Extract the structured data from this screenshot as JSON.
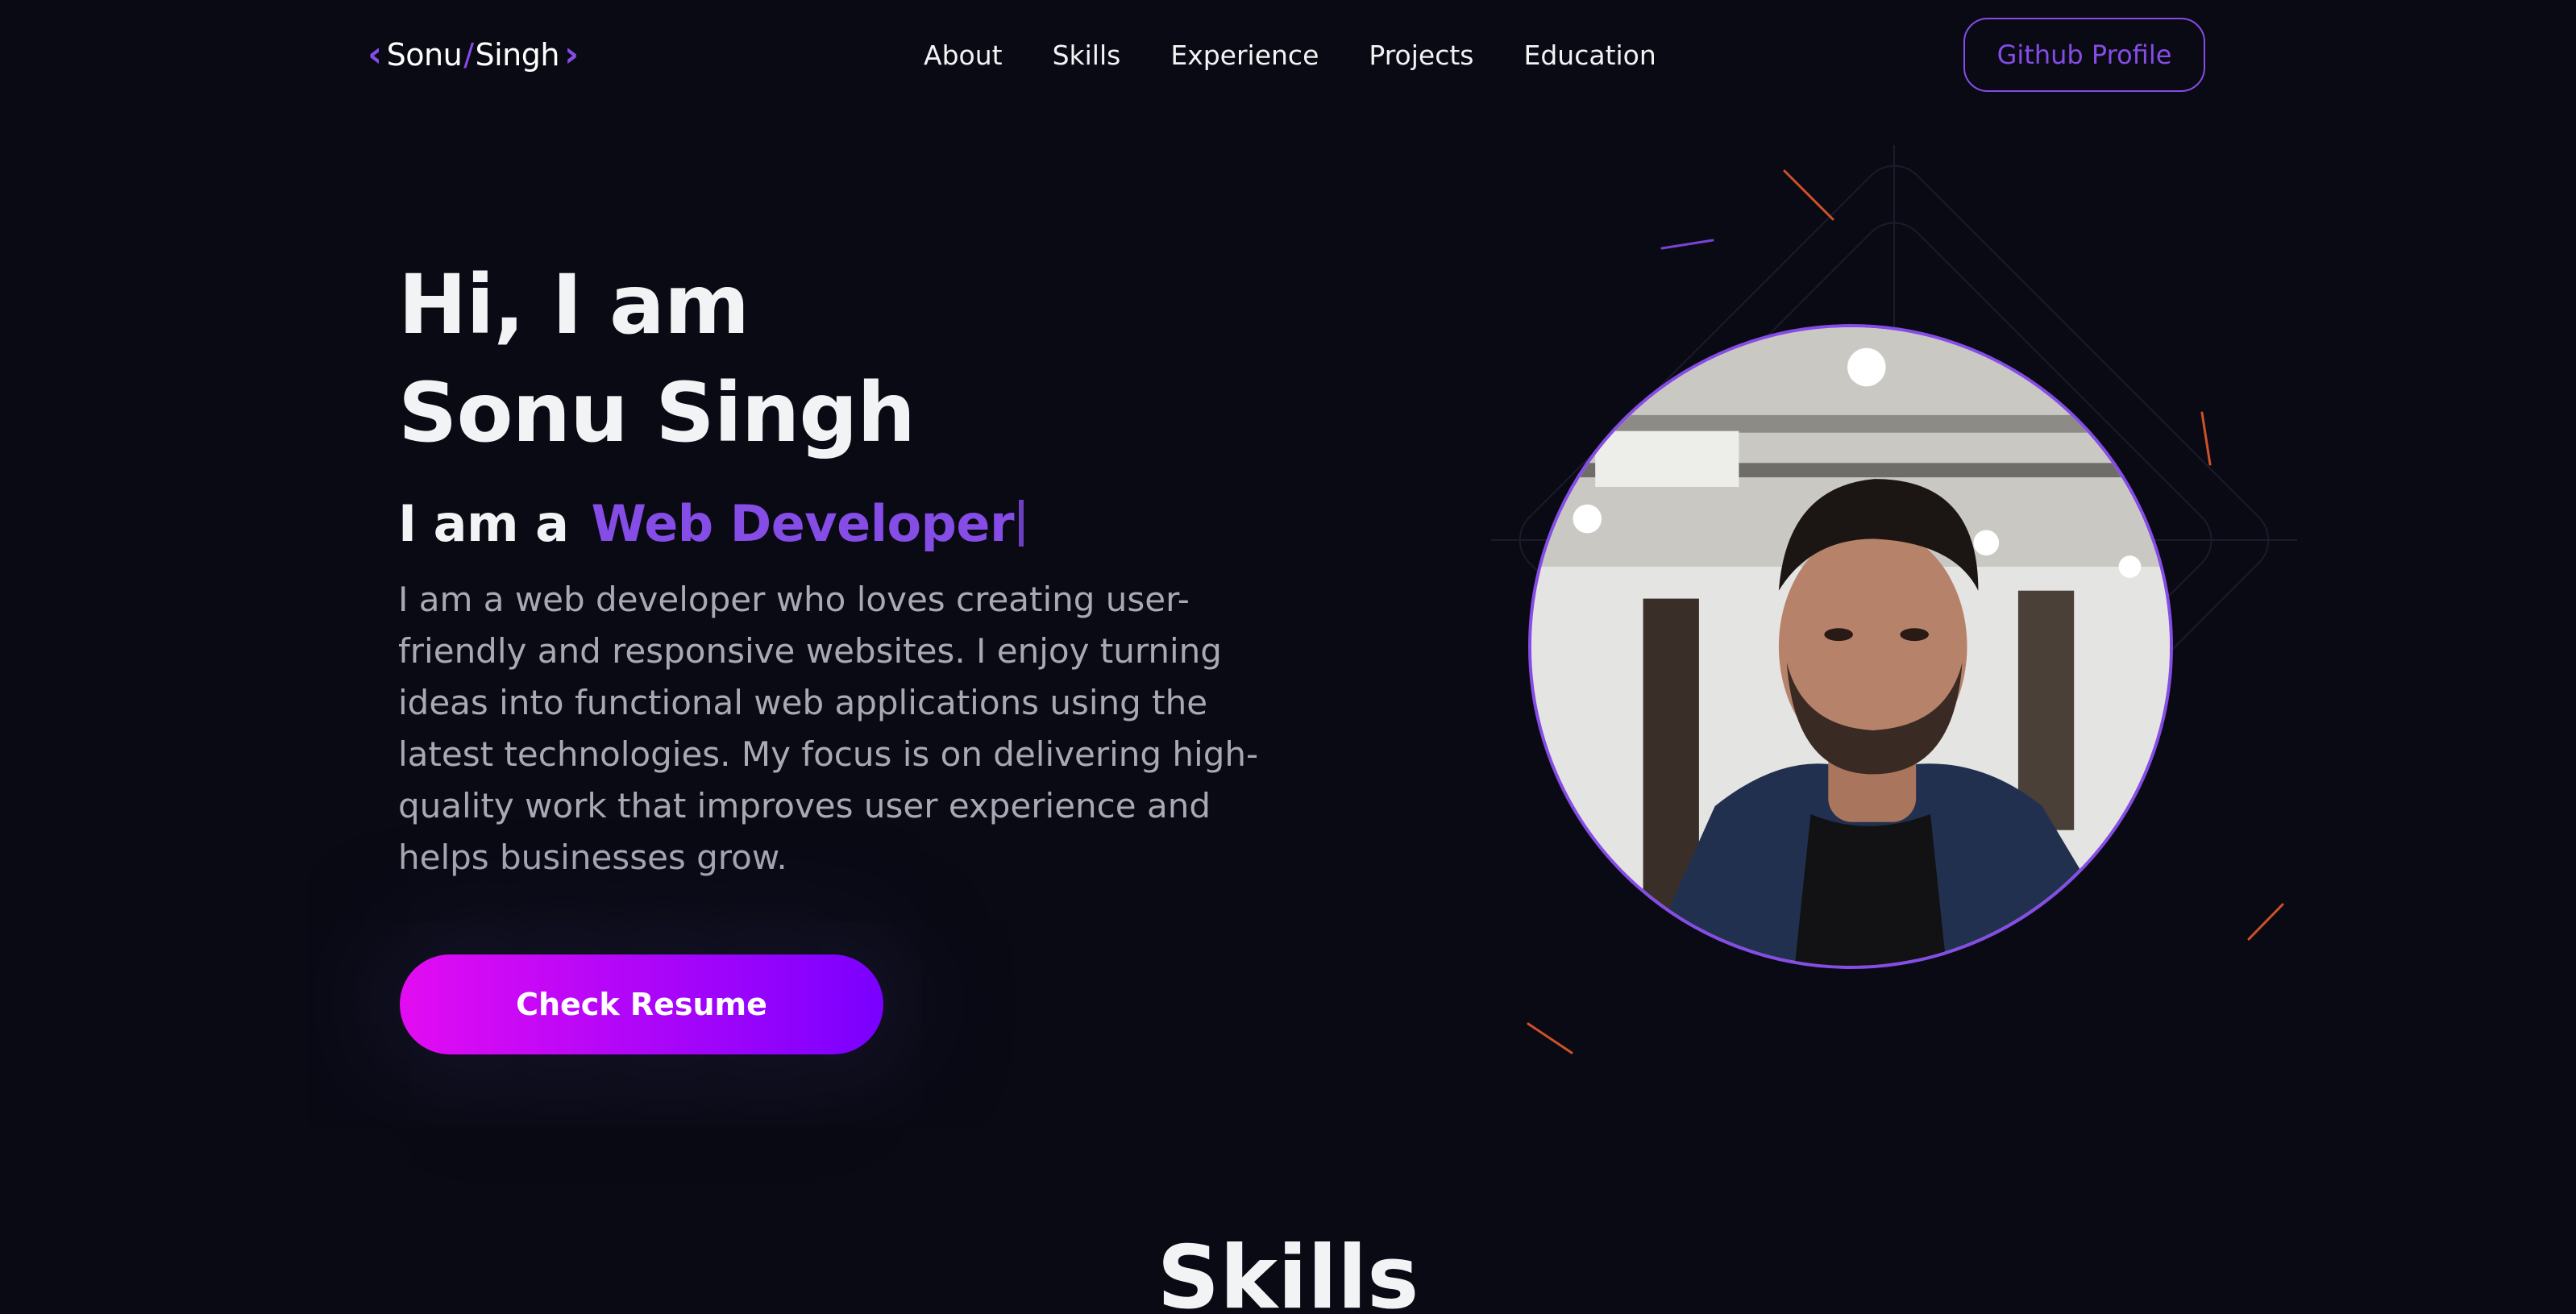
{
  "header": {
    "logo": {
      "first": "Sonu",
      "slash": "/",
      "last": "Singh",
      "left_bracket": "‹",
      "right_bracket": "›"
    },
    "nav": [
      "About",
      "Skills",
      "Experience",
      "Projects",
      "Education"
    ],
    "github_button": "Github Profile"
  },
  "hero": {
    "title_line1": "Hi, I am",
    "title_line2": "Sonu Singh",
    "role_prefix": "I am a",
    "role_typed": "Web Developer",
    "description": "I am a web developer who loves creating user-friendly and responsive websites. I enjoy turning ideas into functional web applications using the latest technologies. My focus is on delivering high-quality work that improves user experience and helps businesses grow.",
    "resume_button": "Check Resume"
  },
  "skills_section": {
    "heading": "Skills"
  },
  "colors": {
    "background": "#0a0a15",
    "accent": "#854ce6",
    "button_gradient_start": "#e30cf2",
    "button_gradient_end": "#7a00ff",
    "text_primary": "#f2f3f4",
    "text_secondary": "#a8a9b4"
  }
}
